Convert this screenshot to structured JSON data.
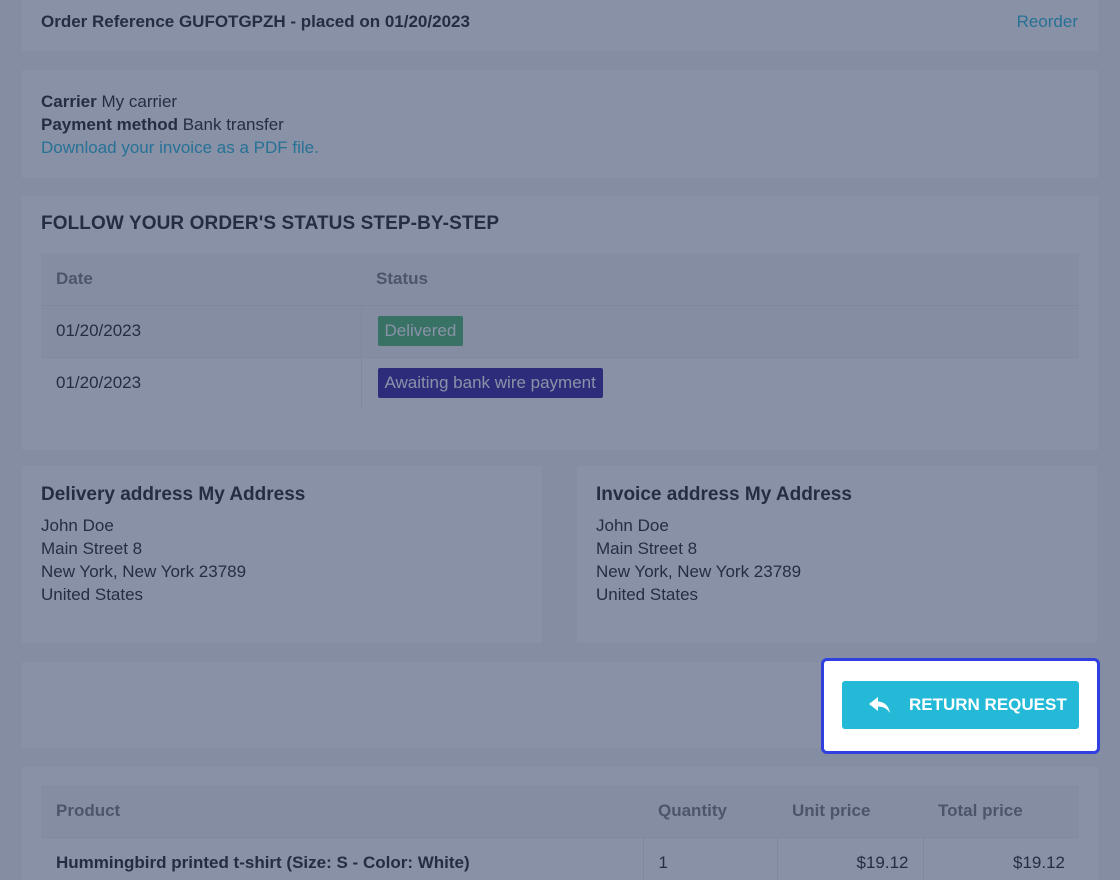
{
  "header": {
    "order_title": "Order Reference GUFOTGPZH - placed on 01/20/2023",
    "reorder_label": "Reorder"
  },
  "details": {
    "carrier_label": "Carrier",
    "carrier_value": "My carrier",
    "payment_label": "Payment method",
    "payment_value": "Bank transfer",
    "invoice_link": "Download your invoice as a PDF file."
  },
  "status_section": {
    "title": "FOLLOW YOUR ORDER'S STATUS STEP-BY-STEP",
    "columns": [
      "Date",
      "Status"
    ],
    "rows": [
      {
        "date": "01/20/2023",
        "status": "Delivered",
        "color": "#4cbb6c"
      },
      {
        "date": "01/20/2023",
        "status": "Awaiting bank wire payment",
        "color": "#34209e"
      }
    ]
  },
  "delivery_address": {
    "title": "Delivery address My Address",
    "lines": [
      "John Doe",
      "Main Street 8",
      "New York, New York 23789",
      "United States"
    ]
  },
  "invoice_address": {
    "title": "Invoice address My Address",
    "lines": [
      "John Doe",
      "Main Street 8",
      "New York, New York 23789",
      "United States"
    ]
  },
  "return_request": {
    "label": "RETURN REQUEST",
    "icon": "reply-arrow-icon"
  },
  "products": {
    "columns": [
      "Product",
      "Quantity",
      "Unit price",
      "Total price"
    ],
    "rows": [
      {
        "name": "Hummingbird printed t-shirt (Size: S - Color: White)",
        "quantity": "1",
        "unit_price": "$19.12",
        "total_price": "$19.12"
      }
    ]
  },
  "colors": {
    "accent": "#24b9d7",
    "highlight_border": "#2f3fe0",
    "overlay": "#28375f"
  }
}
